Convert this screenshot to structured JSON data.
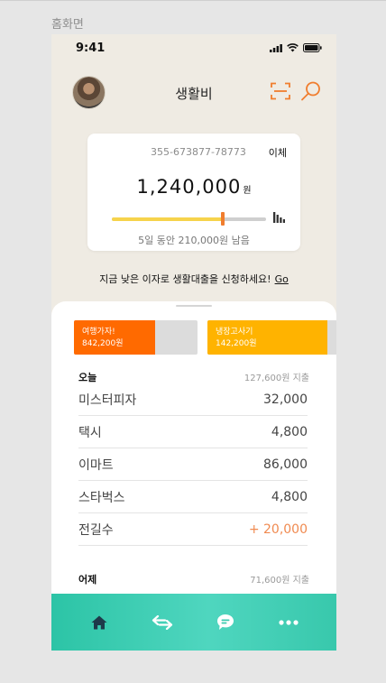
{
  "frame_label": "홈화면",
  "status_bar": {
    "time": "9:41"
  },
  "header": {
    "title": "생활비"
  },
  "account": {
    "number": "355-673877-78773",
    "transfer_label": "이체",
    "balance": "1,240,000",
    "currency": "원",
    "budget_progress": 0.72,
    "budget_text": "5일 동안 210,000원 남음"
  },
  "promo": {
    "text": "지금 낮은 이자로 생활대출을 신청하세요!",
    "link": "Go"
  },
  "goals": [
    {
      "title": "여행가자!",
      "amount": "842,200원",
      "color": "#ff6a00",
      "progress": 0.66
    },
    {
      "title": "냉장고사기",
      "amount": "142,200원",
      "color": "#ffb300",
      "progress": 0.93
    }
  ],
  "today": {
    "label": "오늘",
    "spend": "127,600원 지출",
    "transactions": [
      {
        "name": "미스터피자",
        "amount": "32,000",
        "type": "expense"
      },
      {
        "name": "택시",
        "amount": "4,800",
        "type": "expense"
      },
      {
        "name": "이마트",
        "amount": "86,000",
        "type": "expense"
      },
      {
        "name": "스타벅스",
        "amount": "4,800",
        "type": "expense"
      },
      {
        "name": "전길수",
        "amount": "+ 20,000",
        "type": "income"
      }
    ]
  },
  "yesterday": {
    "label": "어제",
    "spend": "71,600원 지출"
  },
  "colors": {
    "accent": "#f07d2e",
    "teal": "#2cc4a6",
    "income": "#f08a50"
  },
  "tabbar": {
    "icons": [
      "home-icon",
      "transfer-arrows-icon",
      "chat-icon",
      "more-icon"
    ]
  }
}
